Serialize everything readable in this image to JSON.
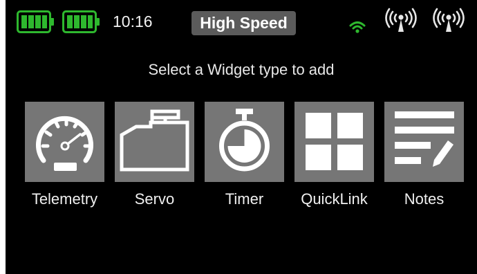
{
  "status_bar": {
    "batteries": [
      {
        "icon": "battery-full-icon",
        "color": "#2eb82e"
      },
      {
        "icon": "battery-full-icon",
        "color": "#2eb82e"
      }
    ],
    "time": "10:16",
    "mode": "High Speed",
    "signal_icons": [
      "wifi-icon",
      "antenna-signal-icon",
      "antenna-signal-icon"
    ],
    "wifi_color": "#2eb82e"
  },
  "heading": "Select a Widget type to add",
  "widgets": [
    {
      "label": "Telemetry",
      "icon": "gauge-icon"
    },
    {
      "label": "Servo",
      "icon": "servo-icon"
    },
    {
      "label": "Timer",
      "icon": "stopwatch-icon"
    },
    {
      "label": "QuickLink",
      "icon": "grid-icon"
    },
    {
      "label": "Notes",
      "icon": "notes-icon"
    }
  ],
  "colors": {
    "background": "#000000",
    "tile": "#767676",
    "badge": "#5b5b5b",
    "battery_green": "#2eb82e",
    "text": "#f0f0f0"
  }
}
